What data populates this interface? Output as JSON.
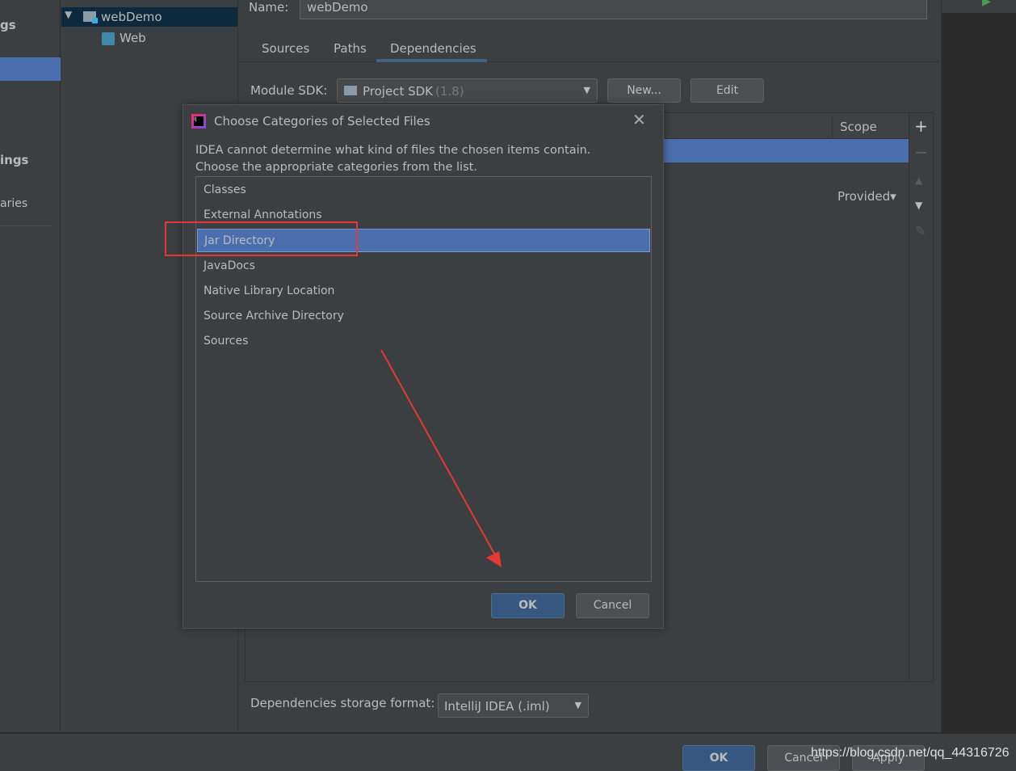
{
  "left_panel": {
    "items": [
      {
        "label": "gs"
      },
      {
        "label": ""
      },
      {
        "label": "ings"
      },
      {
        "label": "aries"
      }
    ]
  },
  "tree": {
    "root": "webDemo",
    "child": "Web"
  },
  "module": {
    "name_label": "Name:",
    "name_value": "webDemo",
    "tabs": [
      "Sources",
      "Paths",
      "Dependencies"
    ],
    "active_tab": "Dependencies",
    "sdk_label": "Module SDK:",
    "sdk_value": "Project SDK",
    "sdk_version": "(1.8)",
    "new_button": "New...",
    "edit_button": "Edit",
    "table_header_scope": "Scope",
    "row_scope": "Provided",
    "storage_label": "Dependencies storage format:",
    "storage_value": "IntelliJ IDEA (.iml)"
  },
  "dialog": {
    "title": "Choose Categories of Selected Files",
    "message_line1": "IDEA cannot determine what kind of files the chosen items contain.",
    "message_line2": "Choose the appropriate categories from the list.",
    "items": [
      "Classes",
      "External Annotations",
      "Jar Directory",
      "JavaDocs",
      "Native Library Location",
      "Source Archive Directory",
      "Sources"
    ],
    "selected": "Jar Directory",
    "ok": "OK",
    "cancel": "Cancel"
  },
  "footer": {
    "ok": "OK",
    "cancel": "Cancel",
    "apply": "Apply"
  },
  "watermark": "https://blog.csdn.net/qq_44316726",
  "colors": {
    "background": "#3c3f41",
    "selection": "#4b6eaf",
    "annotation": "#e53935",
    "editor": "#2b2b2b"
  }
}
